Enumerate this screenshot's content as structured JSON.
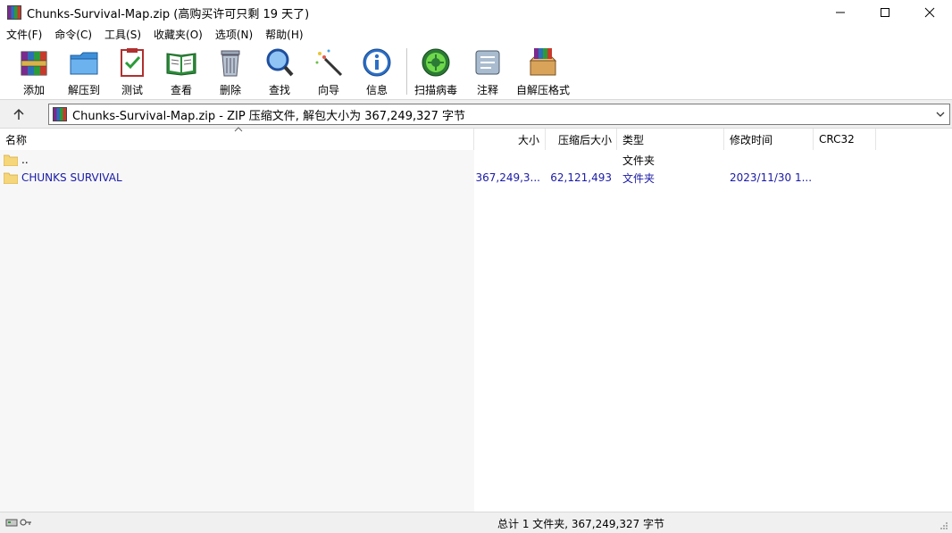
{
  "window": {
    "title": "Chunks-Survival-Map.zip (高购买许可只剩 19 天了)",
    "controls": [
      "minimize-icon",
      "maximize-icon",
      "close-icon"
    ]
  },
  "menu": {
    "items": [
      "文件(F)",
      "命令(C)",
      "工具(S)",
      "收藏夹(O)",
      "选项(N)",
      "帮助(H)"
    ]
  },
  "toolbar": {
    "buttons": [
      {
        "label": "添加",
        "icon": "add-archive-icon"
      },
      {
        "label": "解压到",
        "icon": "extract-to-icon"
      },
      {
        "label": "测试",
        "icon": "test-icon"
      },
      {
        "label": "查看",
        "icon": "view-icon"
      },
      {
        "label": "删除",
        "icon": "delete-icon"
      },
      {
        "label": "查找",
        "icon": "find-icon"
      },
      {
        "label": "向导",
        "icon": "wizard-icon"
      },
      {
        "label": "信息",
        "icon": "info-icon"
      },
      {
        "label": "扫描病毒",
        "icon": "virus-scan-icon"
      },
      {
        "label": "注释",
        "icon": "comment-icon"
      },
      {
        "label": "自解压格式",
        "icon": "sfx-icon"
      }
    ]
  },
  "address": {
    "text": "Chunks-Survival-Map.zip - ZIP 压缩文件, 解包大小为 367,249,327 字节"
  },
  "columns": {
    "name": "名称",
    "size": "大小",
    "packed": "压缩后大小",
    "type": "类型",
    "modified": "修改时间",
    "crc": "CRC32"
  },
  "rows": [
    {
      "name": "..",
      "size": "",
      "packed": "",
      "type": "文件夹",
      "modified": "",
      "crc": ""
    },
    {
      "name": "CHUNKS SURVIVAL",
      "size": "367,249,3...",
      "packed": "62,121,493",
      "type": "文件夹",
      "modified": "2023/11/30 1...",
      "crc": ""
    }
  ],
  "status": {
    "text": "总计 1 文件夹, 367,249,327 字节"
  },
  "colors": {
    "selected_text": "#1a1aa6",
    "folder": "#f5d67b"
  }
}
